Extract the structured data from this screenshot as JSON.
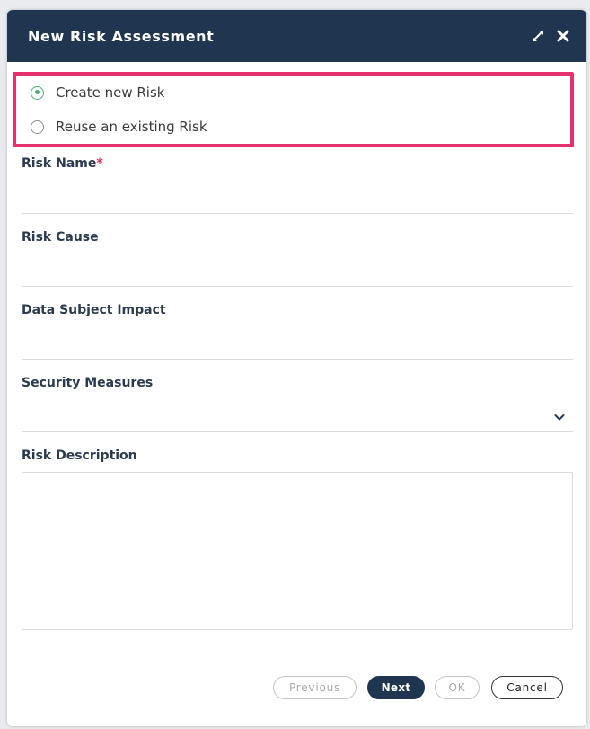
{
  "dialog": {
    "title": "New Risk Assessment",
    "icons": {
      "expand": "expand-icon",
      "close": "close-icon"
    }
  },
  "options": [
    {
      "label": "Create new Risk",
      "selected": true
    },
    {
      "label": "Reuse an existing Risk",
      "selected": false
    }
  ],
  "fields": {
    "risk_name": {
      "label": "Risk Name",
      "required_mark": "*",
      "value": ""
    },
    "risk_cause": {
      "label": "Risk Cause",
      "value": ""
    },
    "data_subject_impact": {
      "label": "Data Subject Impact",
      "value": ""
    },
    "security_measures": {
      "label": "Security Measures",
      "value": ""
    },
    "risk_description": {
      "label": "Risk Description",
      "value": ""
    }
  },
  "buttons": {
    "previous": "Previous",
    "next": "Next",
    "ok": "OK",
    "cancel": "Cancel"
  },
  "colors": {
    "header": "#203550",
    "highlight": "#e5326d",
    "radio_selected": "#4caf72",
    "required": "#e0324b"
  }
}
